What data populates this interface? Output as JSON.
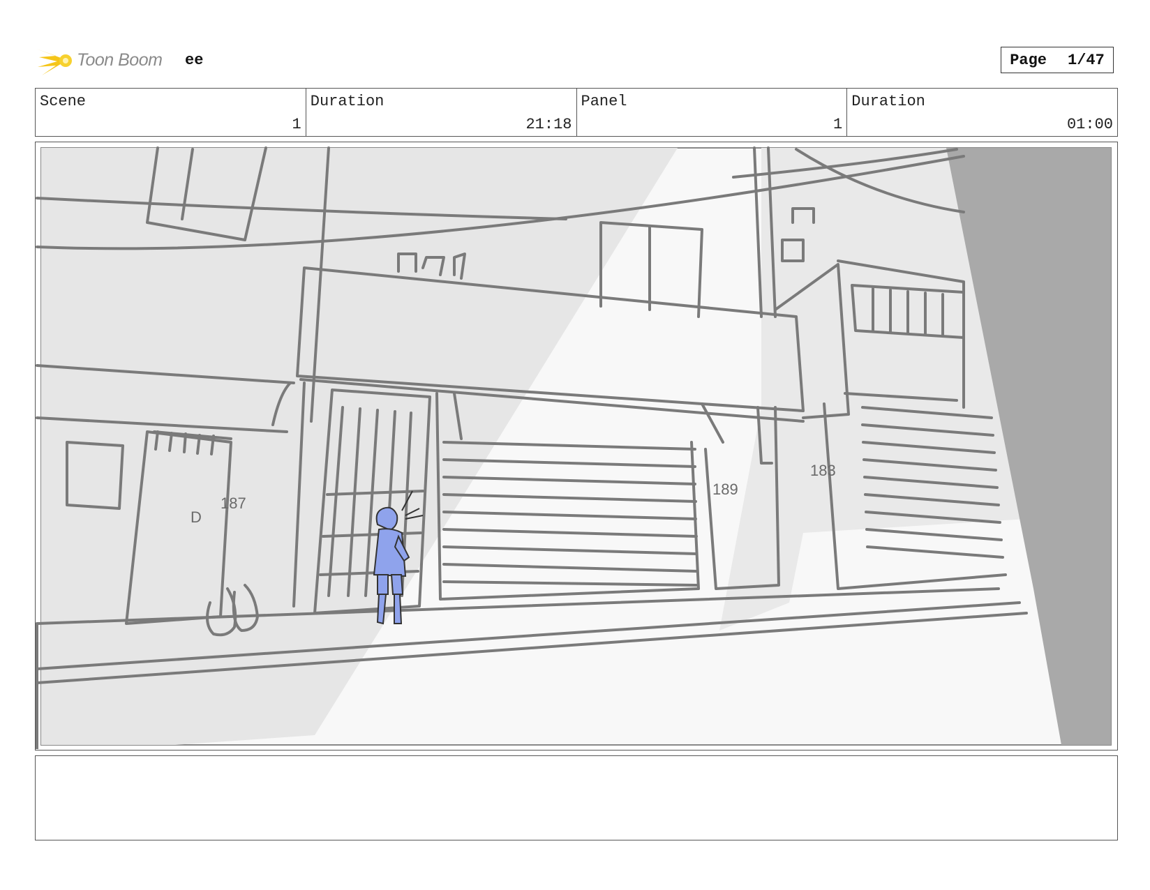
{
  "header": {
    "logo_text": "Toon Boom",
    "project_name": "ee",
    "page_label": "Page",
    "page_number": "1/47"
  },
  "info": [
    {
      "label": "Scene",
      "value": "1"
    },
    {
      "label": "Duration",
      "value": "21:18"
    },
    {
      "label": "Panel",
      "value": "1"
    },
    {
      "label": "Duration",
      "value": "01:00"
    }
  ],
  "panel": {
    "house_numbers": [
      "D",
      "187",
      "189",
      "183"
    ]
  },
  "colors": {
    "sketch_line": "#7a7a7a",
    "shadow": "#e6e6e6",
    "wall_dark": "#a9a9a9",
    "character": "#8fa3ec",
    "logo_yellow": "#f5c518"
  },
  "icons": {
    "logo": "toon-boom-logo-icon"
  }
}
